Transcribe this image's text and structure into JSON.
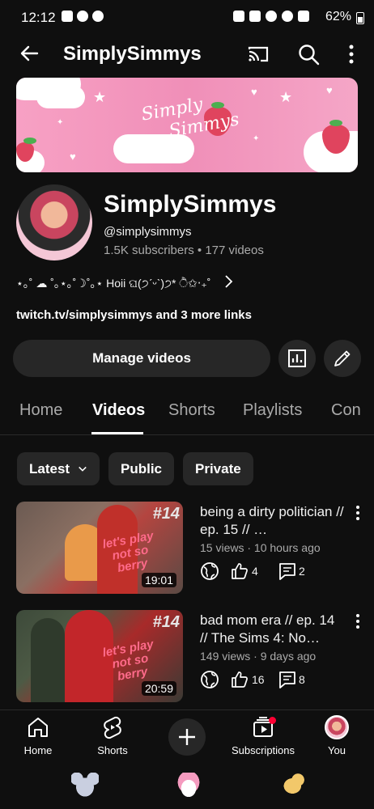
{
  "status_bar": {
    "time": "12:12",
    "battery_text": "62%"
  },
  "app_bar": {
    "title": "SimplySimmys"
  },
  "banner": {
    "brand_line1": "Simply",
    "brand_line2": "Simmys"
  },
  "channel": {
    "name": "SimplySimmys",
    "handle": "@simplysimmys",
    "subscribers": "1.5K subscribers",
    "videos_count": "177 videos",
    "meta_separator": " • ",
    "description": "⋆｡˚ ☁︎ ˚｡⋆｡˚☽˚｡⋆ Hoii ଘ(੭ˊᵕˋ)੭* ੈ✩‧₊˚",
    "links": "twitch.tv/simplysimmys and 3 more links"
  },
  "actions": {
    "manage_label": "Manage videos"
  },
  "tabs": [
    {
      "label": "Home"
    },
    {
      "label": "Videos"
    },
    {
      "label": "Shorts"
    },
    {
      "label": "Playlists"
    },
    {
      "label": "Con"
    }
  ],
  "chips": {
    "latest": "Latest",
    "public": "Public",
    "private": "Private"
  },
  "videos": [
    {
      "title": "being a dirty politician // ep. 15 // …",
      "views": "15 views",
      "age": "10 hours ago",
      "likes": "4",
      "comments": "2",
      "duration": "19:01",
      "thumb_number": "#14",
      "thumb_text": "let's play not so berry"
    },
    {
      "title": "bad mom era // ep. 14 // The Sims 4: No…",
      "views": "149 views",
      "age": "9 days ago",
      "likes": "16",
      "comments": "8",
      "duration": "20:59",
      "thumb_number": "#14",
      "thumb_text": "let's play not so berry"
    }
  ],
  "bottom_nav": {
    "home": "Home",
    "shorts": "Shorts",
    "subscriptions": "Subscriptions",
    "you": "You"
  },
  "colors": {
    "background": "#0f0f0f",
    "surface": "#272727",
    "secondary_text": "#aaaaaa",
    "banner_pink": "#f08fb8",
    "notification_red": "#ff0033"
  }
}
